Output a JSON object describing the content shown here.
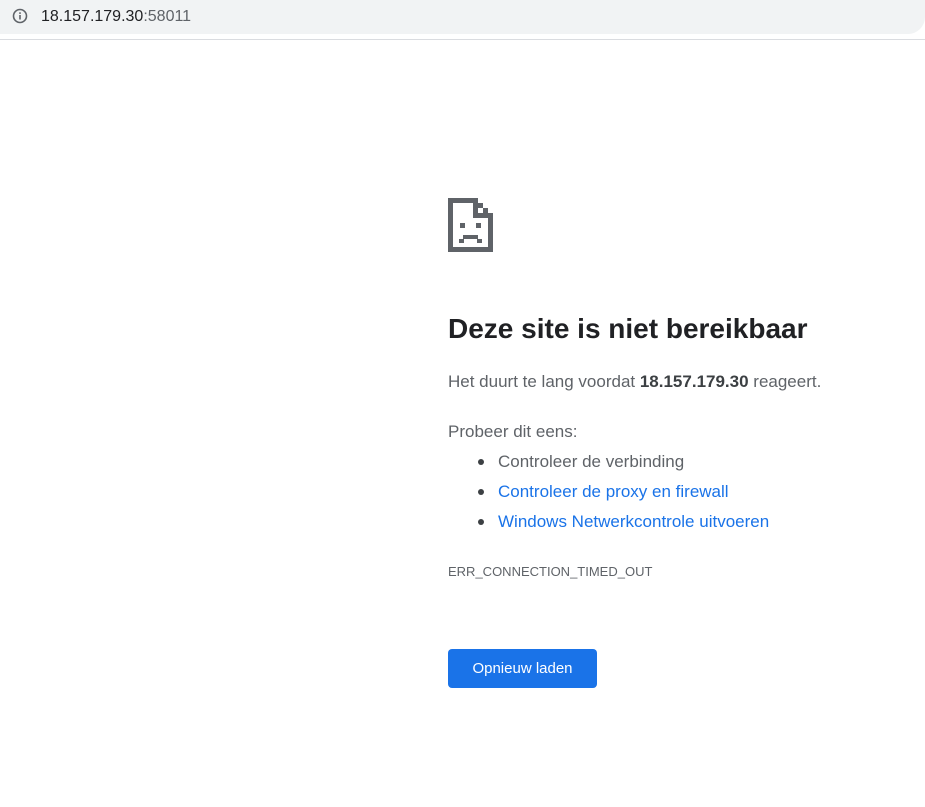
{
  "address_bar": {
    "url_host": "18.157.179.30",
    "url_port": ":58011",
    "icon": "info-icon"
  },
  "error_page": {
    "icon": "sad-page-icon",
    "title": "Deze site is niet bereikbaar",
    "summary_prefix": "Het duurt te lang voordat ",
    "summary_host": "18.157.179.30",
    "summary_suffix": " reageert.",
    "suggestions_heading": "Probeer dit eens:",
    "suggestions": [
      {
        "label": "Controleer de verbinding",
        "is_link": false
      },
      {
        "label": "Controleer de proxy en firewall",
        "is_link": true
      },
      {
        "label": "Windows Netwerkcontrole uitvoeren",
        "is_link": true
      }
    ],
    "error_code": "ERR_CONNECTION_TIMED_OUT",
    "reload_label": "Opnieuw laden"
  },
  "colors": {
    "accent": "#1a73e8",
    "text_primary": "#202124",
    "text_secondary": "#5f6368",
    "address_bar_bg": "#f1f3f4"
  }
}
